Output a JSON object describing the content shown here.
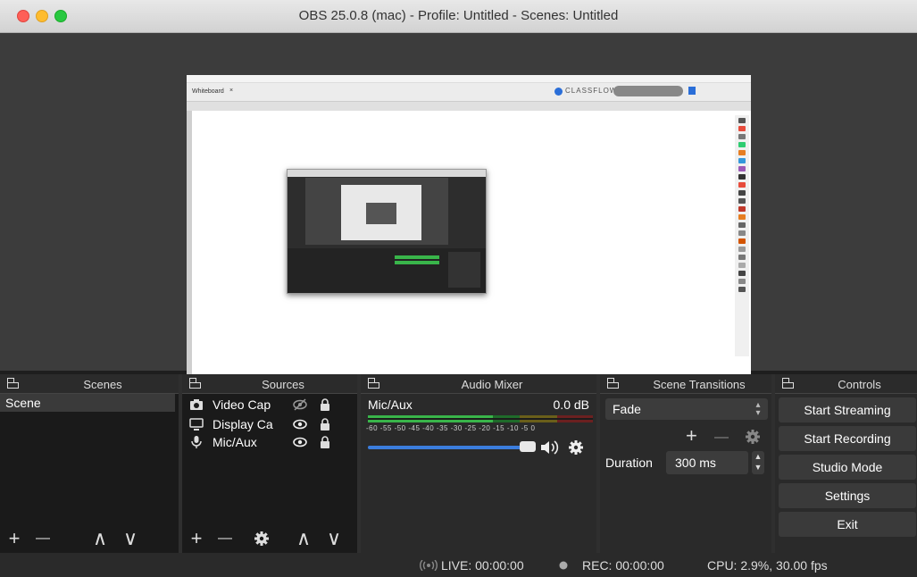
{
  "window": {
    "title": "OBS 25.0.8 (mac) - Profile: Untitled - Scenes: Untitled"
  },
  "preview": {
    "browser_tab_label": "Whiteboard",
    "browser_tab_close": "×",
    "classflow_logo": "CLASSFLOW"
  },
  "docks": {
    "scenes": {
      "title": "Scenes",
      "items": [
        {
          "label": "Scene",
          "selected": true
        }
      ]
    },
    "sources": {
      "title": "Sources",
      "items": [
        {
          "label": "Video Cap",
          "icon": "camera-icon",
          "visible": false,
          "locked": true
        },
        {
          "label": "Display Ca",
          "icon": "monitor-icon",
          "visible": true,
          "locked": true
        },
        {
          "label": "Mic/Aux",
          "icon": "microphone-icon",
          "visible": true,
          "locked": true
        }
      ]
    },
    "audio_mixer": {
      "title": "Audio Mixer",
      "channel": {
        "name": "Mic/Aux",
        "level": "0.0 dB"
      },
      "scale": "-60 -55 -50 -45 -40 -35 -30 -25 -20 -15 -10 -5 0"
    },
    "scene_transitions": {
      "title": "Scene Transitions",
      "transition": "Fade",
      "duration_label": "Duration",
      "duration_value": "300 ms"
    },
    "controls": {
      "title": "Controls",
      "buttons": [
        "Start Streaming",
        "Start Recording",
        "Studio Mode",
        "Settings",
        "Exit"
      ]
    }
  },
  "toolbar_glyphs": {
    "plus": "+",
    "minus": "—",
    "up": "∧",
    "down": "∨"
  },
  "status": {
    "live": "LIVE: 00:00:00",
    "rec": "REC: 00:00:00",
    "cpu": "CPU: 2.9%, 30.00 fps"
  },
  "colors": {
    "accent": "#3b7ddd",
    "meter_green": "#39b54a",
    "meter_yellow": "#c9b52a",
    "meter_red": "#c23b3b"
  }
}
